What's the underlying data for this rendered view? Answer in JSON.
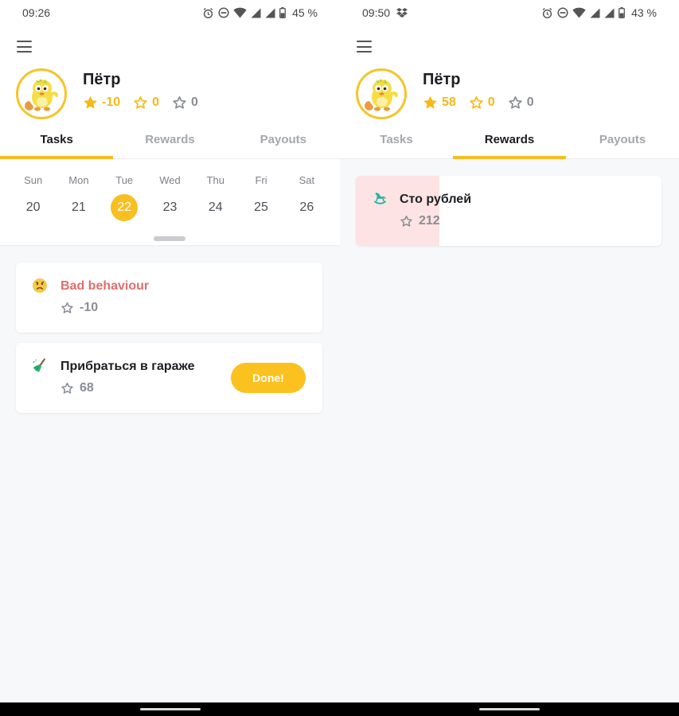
{
  "left": {
    "status": {
      "time": "09:26",
      "battery": "45 %"
    },
    "profile": {
      "name": "Пётр",
      "stats": [
        {
          "value": "-10",
          "icon": "star-filled-icon",
          "color": "#f6b915"
        },
        {
          "value": "0",
          "icon": "star-outline-icon",
          "color": "#f6b915"
        },
        {
          "value": "0",
          "icon": "star-outline-icon",
          "color": "#8a8d95"
        }
      ]
    },
    "tabs": [
      {
        "label": "Tasks",
        "active": true
      },
      {
        "label": "Rewards",
        "active": false
      },
      {
        "label": "Payouts",
        "active": false
      }
    ],
    "calendar": {
      "days": [
        {
          "dow": "Sun",
          "num": "20"
        },
        {
          "dow": "Mon",
          "num": "21"
        },
        {
          "dow": "Tue",
          "num": "22",
          "selected": true
        },
        {
          "dow": "Wed",
          "num": "23"
        },
        {
          "dow": "Thu",
          "num": "24"
        },
        {
          "dow": "Fri",
          "num": "25"
        },
        {
          "dow": "Sat",
          "num": "26"
        }
      ]
    },
    "tasks": [
      {
        "title": "Bad behaviour",
        "points": "-10",
        "icon": "sad-face-icon"
      },
      {
        "title": "Прибраться в гараже",
        "points": "68",
        "icon": "broom-icon",
        "button": "Done!"
      }
    ]
  },
  "right": {
    "status": {
      "time": "09:50",
      "battery": "43 %"
    },
    "profile": {
      "name": "Пётр",
      "stats": [
        {
          "value": "58",
          "icon": "star-filled-icon",
          "color": "#f6b915"
        },
        {
          "value": "0",
          "icon": "star-outline-icon",
          "color": "#f6b915"
        },
        {
          "value": "0",
          "icon": "star-outline-icon",
          "color": "#8a8d95"
        }
      ]
    },
    "tabs": [
      {
        "label": "Tasks",
        "active": false
      },
      {
        "label": "Rewards",
        "active": true
      },
      {
        "label": "Payouts",
        "active": false
      }
    ],
    "rewards": [
      {
        "title": "Сто рублей",
        "points": "212",
        "icon": "rocking-horse-icon"
      }
    ]
  },
  "colors": {
    "accent": "#f8bd21",
    "negative": "#e06e6b",
    "reward_progress": "#fde3e3"
  }
}
